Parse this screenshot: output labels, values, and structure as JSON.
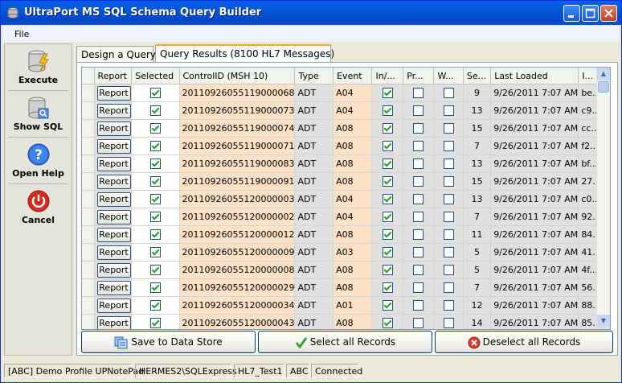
{
  "window": {
    "title": "UltraPort MS SQL Schema Query Builder"
  },
  "menu": {
    "file": "File"
  },
  "sidebar": {
    "items": [
      {
        "label": "Execute",
        "icon": "database-lightning-icon"
      },
      {
        "label": "Show SQL",
        "icon": "database-search-icon"
      },
      {
        "label": "Open Help",
        "icon": "help-icon"
      },
      {
        "label": "Cancel",
        "icon": "power-icon"
      }
    ]
  },
  "tabs": [
    {
      "label": "Design a Query",
      "active": false
    },
    {
      "label": "Query Results (8100 HL7 Messages)",
      "active": true
    }
  ],
  "grid": {
    "columns": [
      "Report",
      "Selected",
      "ControlID (MSH 10)",
      "Type",
      "Event",
      "In/...",
      "Pr...",
      "W...",
      "Se...",
      "Last Loaded",
      "I..."
    ],
    "report_label": "Report",
    "rows": [
      {
        "selected": true,
        "control_id": "20110926055119000068",
        "type": "ADT",
        "event": "A04",
        "inbound": true,
        "pr": false,
        "w": false,
        "seq": "9",
        "last_loaded": "9/26/2011 7:07 AM",
        "id": "be..."
      },
      {
        "selected": true,
        "control_id": "20110926055119000073",
        "type": "ADT",
        "event": "A04",
        "inbound": true,
        "pr": false,
        "w": false,
        "seq": "13",
        "last_loaded": "9/26/2011 7:07 AM",
        "id": "c9..."
      },
      {
        "selected": true,
        "control_id": "20110926055119000074",
        "type": "ADT",
        "event": "A08",
        "inbound": true,
        "pr": false,
        "w": false,
        "seq": "15",
        "last_loaded": "9/26/2011 7:07 AM",
        "id": "cc..."
      },
      {
        "selected": true,
        "control_id": "20110926055119000071",
        "type": "ADT",
        "event": "A08",
        "inbound": true,
        "pr": false,
        "w": false,
        "seq": "7",
        "last_loaded": "9/26/2011 7:07 AM",
        "id": "f2..."
      },
      {
        "selected": true,
        "control_id": "20110926055119000083",
        "type": "ADT",
        "event": "A08",
        "inbound": true,
        "pr": false,
        "w": false,
        "seq": "13",
        "last_loaded": "9/26/2011 7:07 AM",
        "id": "bf..."
      },
      {
        "selected": true,
        "control_id": "20110926055119000091",
        "type": "ADT",
        "event": "A08",
        "inbound": true,
        "pr": false,
        "w": false,
        "seq": "15",
        "last_loaded": "9/26/2011 7:07 AM",
        "id": "27..."
      },
      {
        "selected": true,
        "control_id": "20110926055120000003",
        "type": "ADT",
        "event": "A04",
        "inbound": true,
        "pr": false,
        "w": false,
        "seq": "13",
        "last_loaded": "9/26/2011 7:07 AM",
        "id": "c0..."
      },
      {
        "selected": true,
        "control_id": "20110926055120000002",
        "type": "ADT",
        "event": "A04",
        "inbound": true,
        "pr": false,
        "w": false,
        "seq": "7",
        "last_loaded": "9/26/2011 7:07 AM",
        "id": "92..."
      },
      {
        "selected": true,
        "control_id": "20110926055120000012",
        "type": "ADT",
        "event": "A08",
        "inbound": true,
        "pr": false,
        "w": false,
        "seq": "11",
        "last_loaded": "9/26/2011 7:07 AM",
        "id": "84..."
      },
      {
        "selected": true,
        "control_id": "20110926055120000009",
        "type": "ADT",
        "event": "A03",
        "inbound": true,
        "pr": false,
        "w": false,
        "seq": "5",
        "last_loaded": "9/26/2011 7:07 AM",
        "id": "41..."
      },
      {
        "selected": true,
        "control_id": "20110926055120000008",
        "type": "ADT",
        "event": "A08",
        "inbound": true,
        "pr": false,
        "w": false,
        "seq": "5",
        "last_loaded": "9/26/2011 7:07 AM",
        "id": "4f..."
      },
      {
        "selected": true,
        "control_id": "20110926055120000029",
        "type": "ADT",
        "event": "A08",
        "inbound": true,
        "pr": false,
        "w": false,
        "seq": "7",
        "last_loaded": "9/26/2011 7:07 AM",
        "id": "56..."
      },
      {
        "selected": true,
        "control_id": "20110926055120000034",
        "type": "ADT",
        "event": "A01",
        "inbound": true,
        "pr": false,
        "w": false,
        "seq": "12",
        "last_loaded": "9/26/2011 7:07 AM",
        "id": "88..."
      },
      {
        "selected": true,
        "control_id": "20110926055120000043",
        "type": "ADT",
        "event": "A08",
        "inbound": true,
        "pr": false,
        "w": false,
        "seq": "14",
        "last_loaded": "9/26/2011 7:07 AM",
        "id": "85..."
      }
    ]
  },
  "buttons": {
    "save": "Save to Data Store",
    "select_all": "Select all Records",
    "deselect_all": "Deselect all Records"
  },
  "status": {
    "profile": "[ABC] Demo Profile UPNotePad",
    "server": "HERMES2\\SQLExpress",
    "database": "HL7_Test1",
    "code": "ABC",
    "connection": "Connected"
  }
}
